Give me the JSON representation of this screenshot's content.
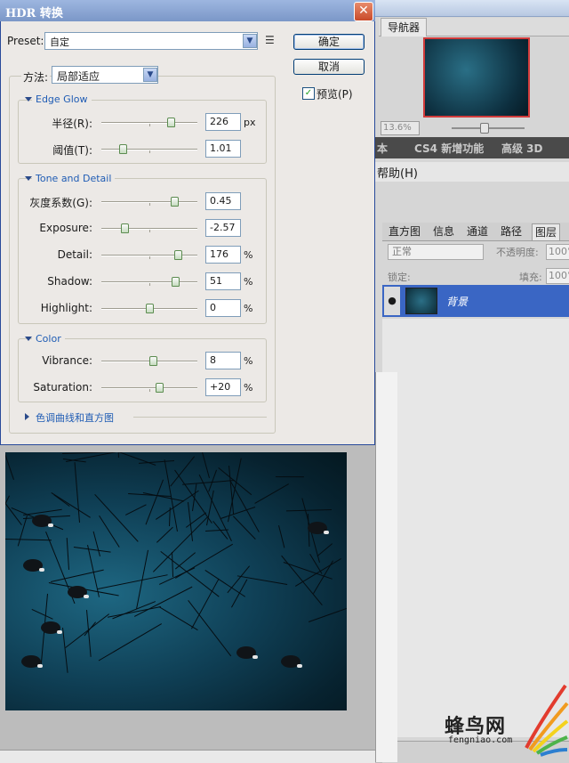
{
  "dialog": {
    "title": "HDR 转换",
    "close_label": "✕",
    "preset_label": "Preset:",
    "preset_value": "自定",
    "ok_label": "确定",
    "cancel_label": "取消",
    "preview_label": "预览(P)",
    "preview_checked": "✓",
    "method_label": "方法:",
    "method_value": "局部适应",
    "edge_glow": {
      "title": "Edge Glow",
      "radius": {
        "label": "半径(R):",
        "value": "226",
        "unit": "px",
        "level": 0.72
      },
      "threshold": {
        "label": "阈值(T):",
        "value": "1.01",
        "unit": "",
        "level": 0.22
      }
    },
    "tone_detail": {
      "title": "Tone and Detail",
      "gamma": {
        "label": "灰度系数(G):",
        "value": "0.45",
        "unit": "",
        "level": 0.76
      },
      "exposure": {
        "label": "Exposure:",
        "value": "-2.57",
        "unit": "",
        "level": 0.24
      },
      "detail": {
        "label": "Detail:",
        "value": "176",
        "unit": "%",
        "level": 0.8
      },
      "shadow": {
        "label": "Shadow:",
        "value": "51",
        "unit": "%",
        "level": 0.77
      },
      "highlight": {
        "label": "Highlight:",
        "value": "0",
        "unit": "%",
        "level": 0.5
      }
    },
    "color": {
      "title": "Color",
      "vibrance": {
        "label": "Vibrance:",
        "value": "8",
        "unit": "%",
        "level": 0.54
      },
      "saturation": {
        "label": "Saturation:",
        "value": "+20",
        "unit": "%",
        "level": 0.6
      }
    },
    "curve_section": "色调曲线和直方图"
  },
  "navigator": {
    "tab": "导航器",
    "zoom": "13.6%"
  },
  "menu": {
    "items": [
      "本",
      "CS4 新增功能",
      "高级 3D"
    ],
    "help": "帮助(H)"
  },
  "layers": {
    "tabs": [
      "直方图",
      "信息",
      "通道",
      "路径",
      "图层"
    ],
    "blend_mode": "正常",
    "opacity_label": "不透明度:",
    "opacity_value": "100°",
    "lock_label": "锁定:",
    "fill_label": "填充:",
    "fill_value": "100°",
    "layer_name": "背景"
  },
  "watermark": {
    "title": "蜂鸟网",
    "url": "fengniao.com"
  },
  "colors": {
    "dialog_bg": "#ece9e6",
    "titlebar": "#7b97c8",
    "group_title": "#1f5cb4",
    "layer_selected": "#3a66c4",
    "photo_teal": "#1e6782"
  }
}
